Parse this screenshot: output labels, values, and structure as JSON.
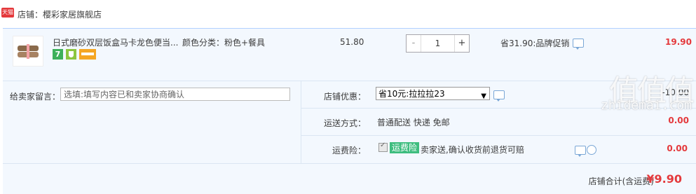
{
  "shop": {
    "badge": "天猫",
    "name": "店铺：樱彩家居旗舰店"
  },
  "item": {
    "title": "日式磨砂双层饭盒马卡龙色便当...",
    "sku": "颜色分类：粉色+餐具",
    "badge_7": "7",
    "price": "51.80",
    "qty_minus": "-",
    "quantity": "1",
    "qty_plus": "+",
    "promo": "省31.90:品牌促销",
    "subtotal": "19.90"
  },
  "message": {
    "label": "给卖家留言：",
    "placeholder": "选填:填写内容已和卖家协商确认"
  },
  "discount": {
    "label": "店铺优惠：",
    "selected": "省10元:拉拉拉23",
    "caret": "▼",
    "amount": "-10.00"
  },
  "shipping": {
    "label": "运送方式：",
    "value": "普通配送 快递 免邮",
    "amount": "0.00"
  },
  "insurance": {
    "label": "运费险：",
    "badge": "运费险",
    "text": "卖家送,确认收货前退货可赔",
    "amount": "0.00"
  },
  "total": {
    "label": "店铺合计(含运费)",
    "value": "¥9.90"
  },
  "watermark": {
    "main": "值值值",
    "sub": "zhidemai.com"
  },
  "colors": {
    "accent_red": "#e4393c",
    "panel_bg": "#f3f8fe",
    "insurance_green": "#3ebd7f"
  }
}
